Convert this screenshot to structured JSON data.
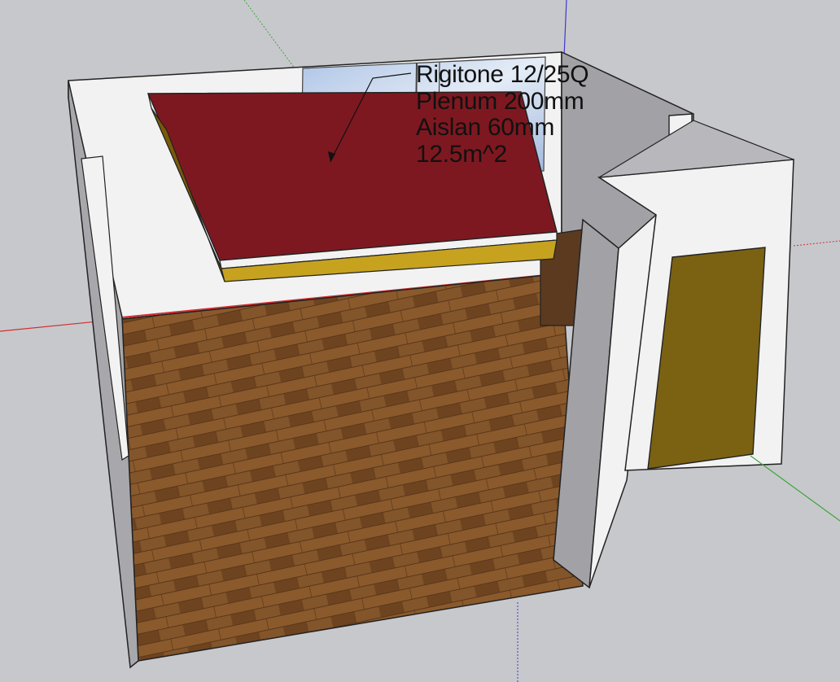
{
  "annotation": {
    "lines": [
      "Rigitone 12/25Q",
      "Plenum 200mm",
      "Aislan 60mm",
      "12.5m^2"
    ]
  },
  "colors": {
    "viewport_background": "#c7c8cc",
    "ceiling_panel": "#7e1820",
    "insulation_edge": "#7a5a08",
    "insulation_face": "#c6a21f",
    "floor_wood": "#7a4c24",
    "wall": "#f2f2f2",
    "door": "#7b6212",
    "red_axis": "#d03030",
    "green_axis": "#3fa53f",
    "blue_axis": "#3a3ad0"
  }
}
